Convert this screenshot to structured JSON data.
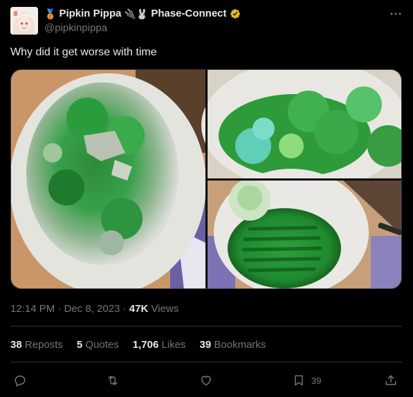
{
  "author": {
    "display_name": "Pipkin Pippa",
    "name_prefix_emoji": "🥉",
    "name_suffix_emoji": "🔌🐰",
    "affiliation": "Phase-Connect",
    "handle": "@pipkinpippa",
    "verified_color": "#e2b719"
  },
  "tweet": {
    "text": "Why did it get worse with time",
    "time": "12:14 PM",
    "date": "Dec 8, 2023",
    "views_count": "47K",
    "views_label": "Views"
  },
  "stats": [
    {
      "count": "38",
      "label": "Reposts"
    },
    {
      "count": "5",
      "label": "Quotes"
    },
    {
      "count": "1,706",
      "label": "Likes"
    },
    {
      "count": "39",
      "label": "Bookmarks"
    }
  ],
  "actions": {
    "reply_icon": "reply-icon",
    "retweet_icon": "retweet-icon",
    "like_icon": "heart-icon",
    "bookmark_icon": "bookmark-icon",
    "bookmark_count": "39",
    "share_icon": "share-icon"
  },
  "colors": {
    "background": "#000000",
    "text_primary": "#e7e9ea",
    "text_secondary": "#71767b",
    "divider": "#2f3336"
  }
}
